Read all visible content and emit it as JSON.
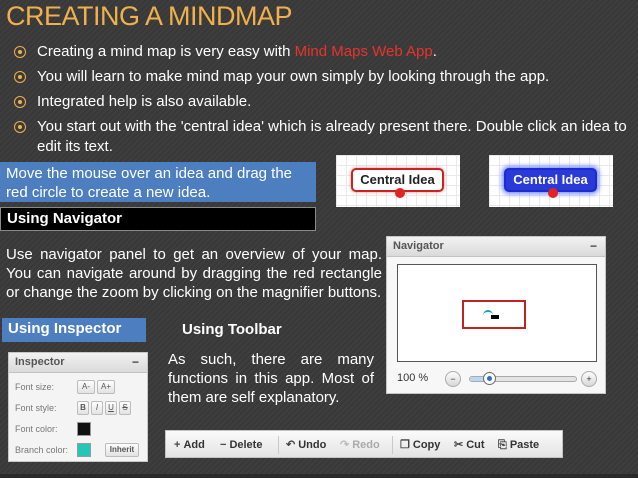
{
  "slide": {
    "title": "CREATING A MINDMAP",
    "bullets": [
      {
        "prefix": "Creating a mind map is very easy with ",
        "highlight": "Mind Maps Web App",
        "suffix": "."
      },
      {
        "text": "You will learn to make mind map your own simply by looking through the app."
      },
      {
        "text": "Integrated help is also available."
      },
      {
        "text": " You start out with the 'central idea' which is already present there. Double click an idea to edit its text."
      }
    ],
    "drag_tip": "Move the mouse over an idea and drag the red circle to create a new idea.",
    "navigator_heading": "Using Navigator",
    "navigator_text": "Use navigator panel to get an overview of your map. You can navigate around by dragging the red rectangle or change the zoom by clicking on the magnifier buttons.",
    "inspector_heading": "Using Inspector",
    "toolbar_heading": "Using Toolbar",
    "toolbar_text": "As such, there are many functions in this app. Most of them are self explanatory."
  },
  "idea_examples": {
    "normal_label": "Central Idea",
    "selected_label": "Central Idea"
  },
  "navigator_panel": {
    "title": "Navigator",
    "collapse_symbol": "−",
    "zoom_label": "100 %",
    "zoom_out_symbol": "−",
    "zoom_in_symbol": "+",
    "zoom_fraction": 0.18
  },
  "inspector_panel": {
    "title": "Inspector",
    "collapse_symbol": "−",
    "font_size_label": "Font size:",
    "font_size_down": "A-",
    "font_size_up": "A+",
    "font_style_label": "Font style:",
    "style_bold": "B",
    "style_italic": "I",
    "style_underline": "U",
    "style_strike": "S",
    "font_color_label": "Font color:",
    "font_color": "#111111",
    "branch_color_label": "Branch color:",
    "branch_color": "#22c7b8",
    "inherit_label": "Inherit"
  },
  "toolbar": {
    "add_icon": "+",
    "add": "Add",
    "delete_icon": "−",
    "delete": "Delete",
    "undo_icon": "↶",
    "undo": "Undo",
    "redo_icon": "↷",
    "redo": "Redo",
    "copy_icon": "❐",
    "copy": "Copy",
    "cut_icon": "✂",
    "cut": "Cut",
    "paste_icon": "⎘",
    "paste": "Paste"
  },
  "colors": {
    "title": "#f0b14c",
    "highlight": "#e8332a",
    "callout_blue": "#4d7fc0",
    "navigator_rect": "#c22222"
  }
}
